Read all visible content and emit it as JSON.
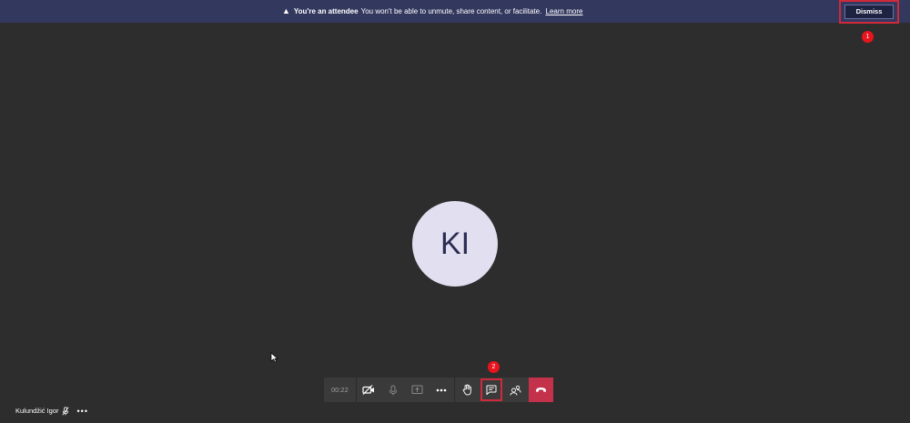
{
  "banner": {
    "icon": "warning-icon",
    "title": "You're an attendee",
    "message": "You won't be able to unmute, share content, or facilitate.",
    "link": "Learn more",
    "dismiss_label": "Dismiss"
  },
  "annotations": {
    "badge1": "1",
    "badge2": "2"
  },
  "participant": {
    "initials": "KI",
    "self_name": "Kulundžić Igor"
  },
  "toolbar": {
    "timer": "00:22",
    "buttons": [
      {
        "name": "camera-off-icon"
      },
      {
        "name": "mic-icon"
      },
      {
        "name": "share-icon"
      },
      {
        "name": "more-icon"
      },
      {
        "name": "raise-hand-icon"
      },
      {
        "name": "chat-icon"
      },
      {
        "name": "participants-icon"
      },
      {
        "name": "hang-up-icon"
      }
    ]
  },
  "colors": {
    "stage": "#2e2d2d",
    "banner": "#33385f",
    "hangup": "#c4314b",
    "highlight": "#d0293a",
    "badge": "#e8141e",
    "avatar": "#e1dff0"
  }
}
